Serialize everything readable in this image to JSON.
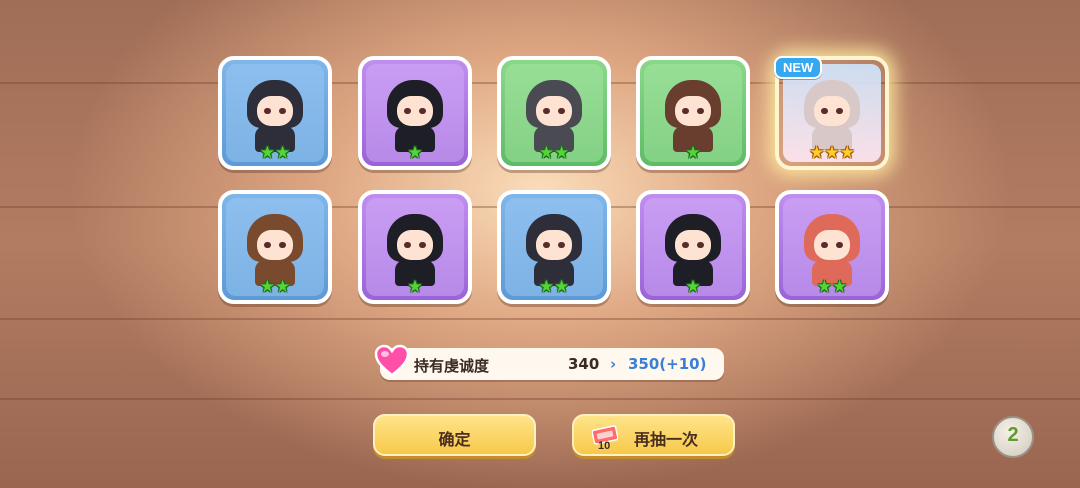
{
  "result_cards": [
    {
      "color": "blue",
      "stars": 2,
      "star_color": "green",
      "is_new": false
    },
    {
      "color": "purple",
      "stars": 1,
      "star_color": "green",
      "is_new": false
    },
    {
      "color": "green",
      "stars": 2,
      "star_color": "green",
      "is_new": false
    },
    {
      "color": "green",
      "stars": 1,
      "star_color": "green",
      "is_new": false
    },
    {
      "color": "gold",
      "stars": 3,
      "star_color": "yellow",
      "is_new": true
    },
    {
      "color": "blue",
      "stars": 2,
      "star_color": "green",
      "is_new": false
    },
    {
      "color": "purple",
      "stars": 1,
      "star_color": "green",
      "is_new": false
    },
    {
      "color": "blue",
      "stars": 2,
      "star_color": "green",
      "is_new": false
    },
    {
      "color": "purple",
      "stars": 1,
      "star_color": "green",
      "is_new": false
    },
    {
      "color": "purple",
      "stars": 2,
      "star_color": "green",
      "is_new": false
    }
  ],
  "new_badge": "NEW",
  "piety": {
    "label": "持有虔诚度",
    "current": "340",
    "arrow": "›",
    "new_value": "350(+10)",
    "icon": "heart-icon"
  },
  "buttons": {
    "confirm": "确定",
    "draw_again": "再抽一次",
    "draw_cost": "10"
  },
  "corner_button": {
    "label": "2",
    "icon": "speed-toggle-icon"
  }
}
